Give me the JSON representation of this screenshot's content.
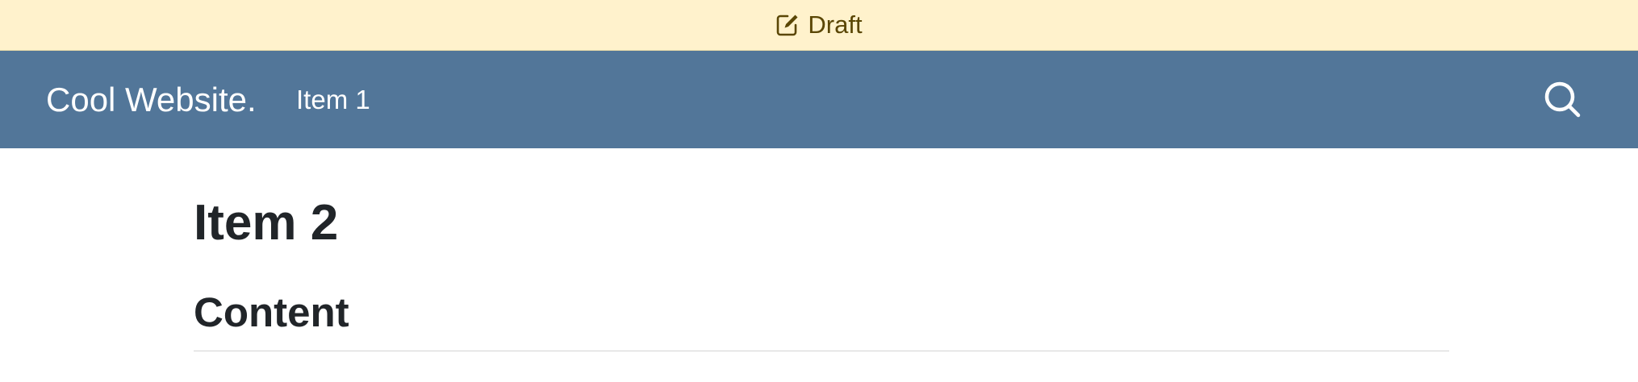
{
  "draft_banner": {
    "icon": "edit-icon",
    "label": "Draft"
  },
  "navbar": {
    "brand": "Cool Website.",
    "items": [
      {
        "label": "Item 1"
      }
    ],
    "search_icon": "search-icon"
  },
  "main": {
    "title": "Item 2",
    "section_heading": "Content"
  },
  "colors": {
    "banner_bg": "#fff2cc",
    "banner_text": "#5a4604",
    "navbar_bg": "#527699",
    "heading_text": "#212529"
  }
}
